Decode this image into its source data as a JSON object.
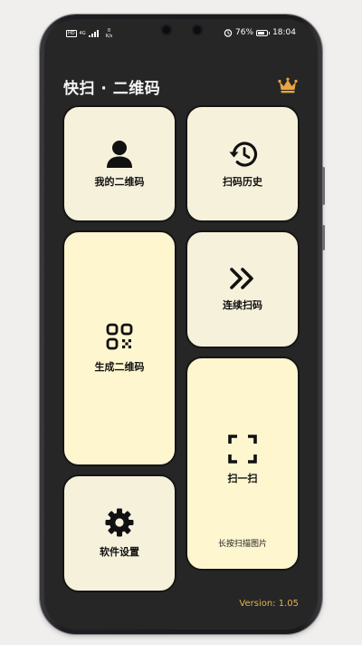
{
  "status_bar": {
    "hd_label": "HD",
    "signal_label": "4G",
    "speed_value": "0",
    "speed_unit": "K/s",
    "battery_percent": "76%",
    "battery_level": 0.76,
    "time": "18:04"
  },
  "header": {
    "title": "快扫 · 二维码",
    "premium_icon": "crown-icon"
  },
  "tiles": {
    "my_qrcode": {
      "label": "我的二维码",
      "icon": "person-icon"
    },
    "scan_history": {
      "label": "扫码历史",
      "icon": "history-icon"
    },
    "generate_qrcode": {
      "label": "生成二维码",
      "icon": "qrcode-icon"
    },
    "continuous_scan": {
      "label": "连续扫码",
      "icon": "double-chevron-right-icon"
    },
    "scan": {
      "label": "扫一扫",
      "icon": "scan-frame-icon",
      "hint": "长按扫描图片"
    },
    "settings": {
      "label": "软件设置",
      "icon": "gear-icon"
    }
  },
  "footer": {
    "version": "Version: 1.05"
  },
  "colors": {
    "background": "#262626",
    "tile_cream": "#f6f1db",
    "tile_yellow": "#fdf6cf",
    "accent_gold": "#e2b34d"
  }
}
